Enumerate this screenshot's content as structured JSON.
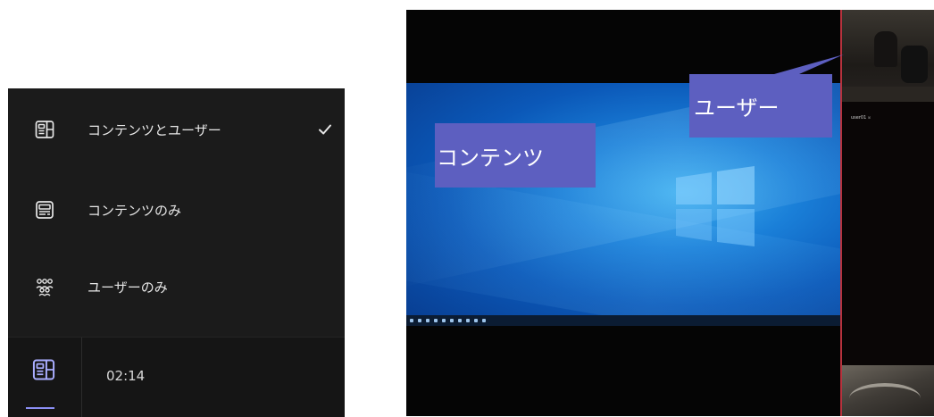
{
  "layout_menu": {
    "items": [
      {
        "label": "コンテンツとユーザー",
        "icon": "content-and-people-icon",
        "selected": true
      },
      {
        "label": "コンテンツのみ",
        "icon": "content-only-icon",
        "selected": false
      },
      {
        "label": "ユーザーのみ",
        "icon": "people-only-icon",
        "selected": false
      }
    ],
    "footer": {
      "layout_button_icon": "layout-icon",
      "timer": "02:14"
    }
  },
  "meeting_view": {
    "annotations": {
      "content_label": "コンテンツ",
      "user_label": "ユーザー"
    },
    "participant_name": "user01 ৪",
    "colors": {
      "annotation_bg": "#5d5fc0",
      "accent": "#8b8ff5",
      "panel_border": "#b7323d"
    }
  }
}
